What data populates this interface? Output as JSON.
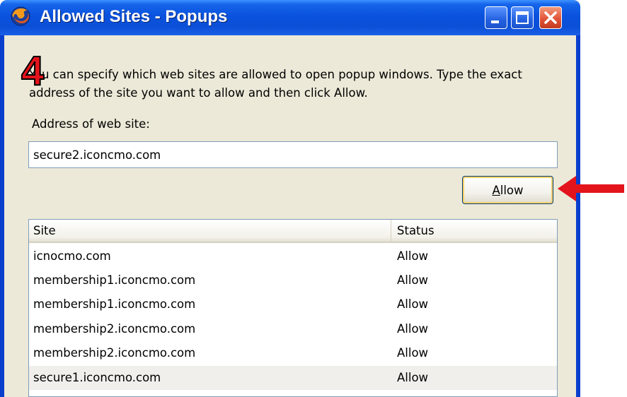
{
  "window": {
    "title": "Allowed Sites - Popups",
    "app_icon": "firefox-icon",
    "controls": {
      "minimize": "minimize-icon",
      "maximize": "maximize-icon",
      "close": "close-icon"
    }
  },
  "annotation": {
    "step_number": "4",
    "arrow_color": "#e3141c"
  },
  "intro_text": "You can specify which web sites are allowed to open popup windows. Type the exact address of the site you want to allow and then click Allow.",
  "address_label": "Address of web site:",
  "address_value": "secure2.iconcmo.com",
  "allow_button": {
    "accel": "A",
    "rest": "llow"
  },
  "table": {
    "headers": {
      "site": "Site",
      "status": "Status"
    },
    "rows": [
      {
        "site": "icnocmo.com",
        "status": "Allow"
      },
      {
        "site": "membership1.iconcmo.com",
        "status": "Allow"
      },
      {
        "site": "membership1.iconcmo.com",
        "status": "Allow"
      },
      {
        "site": "membership2.iconcmo.com",
        "status": "Allow"
      },
      {
        "site": "membership2.iconcmo.com",
        "status": "Allow"
      },
      {
        "site": "secure1.iconcmo.com",
        "status": "Allow"
      }
    ]
  },
  "colors": {
    "titlebar": "#0a52de",
    "dialog_bg": "#ece9d8",
    "close_button": "#e2553a"
  }
}
